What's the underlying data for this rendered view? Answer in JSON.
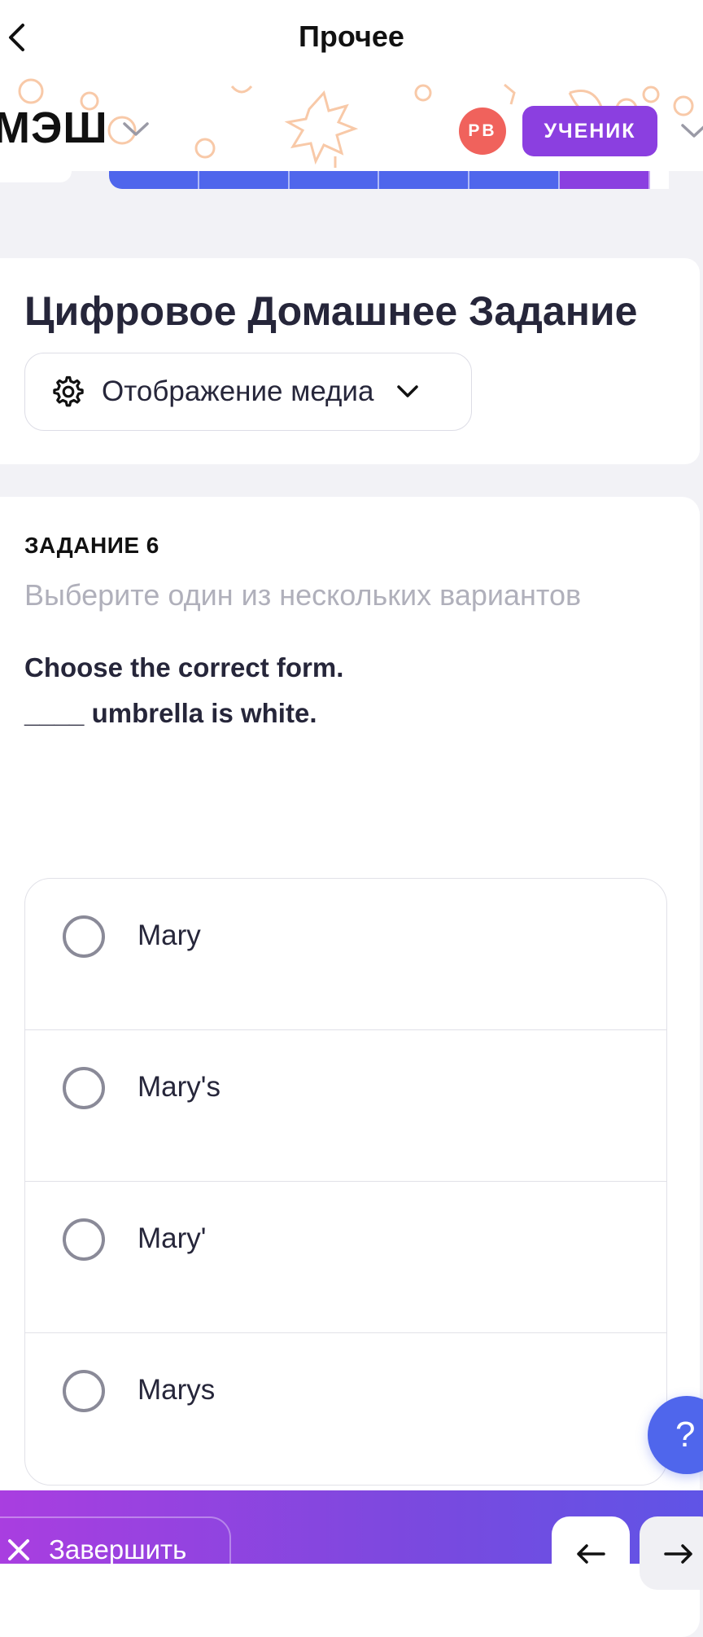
{
  "nav": {
    "title": "Прочее",
    "back_icon": "chevron-left-icon"
  },
  "header": {
    "logo_text": "МЭШ",
    "avatar_initials": "РВ",
    "avatar_color": "#f0625c",
    "role_label": "УЧЕНИК",
    "role_color": "#8b3fe0",
    "decor_color": "#f8c9a8"
  },
  "progress": {
    "completed_color": "#4f66ec",
    "current_color": "#8b3fe0"
  },
  "page": {
    "title": "Цифровое Домашнее Задание",
    "media_button_label": "Отображение медиа"
  },
  "task": {
    "number_label": "ЗАДАНИЕ 6",
    "hint": "Выберите один из нескольких вариантов",
    "question_line1": "Choose the correct form.",
    "question_line2": "____ umbrella is white.",
    "options": [
      {
        "label": "Mary",
        "selected": false
      },
      {
        "label": "Mary's",
        "selected": false
      },
      {
        "label": "Mary'",
        "selected": false
      },
      {
        "label": "Marys",
        "selected": false
      }
    ]
  },
  "help": {
    "label": "?"
  },
  "footer": {
    "finish_label": "Завершить",
    "accent_color": "#7a49df"
  }
}
